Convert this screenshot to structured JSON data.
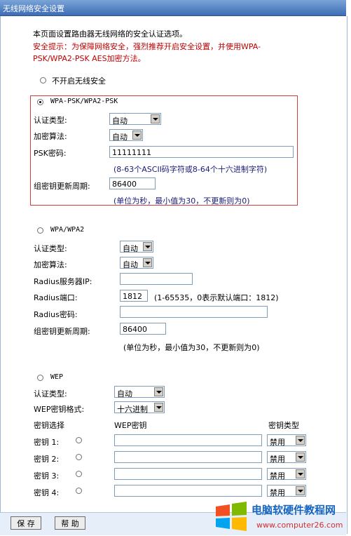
{
  "window": {
    "title": "无线网络安全设置"
  },
  "intro": {
    "line1": "本页面设置路由器无线网络的安全认证选项。",
    "hint_line1": "安全提示：为保障网络安全，强烈推荐开启安全设置，并使用WPA-",
    "hint_line2": "PSK/WPA2-PSK AES加密方法。"
  },
  "no_security": {
    "label": "不开启无线安全",
    "selected": false
  },
  "wpa_psk": {
    "title": "WPA-PSK/WPA2-PSK",
    "selected": true,
    "auth_label": "认证类型:",
    "auth_value": "自动",
    "enc_label": "加密算法:",
    "enc_value": "自动",
    "psk_label": "PSK密码:",
    "psk_value": "11111111",
    "psk_hint": "(8-63个ASCII码字符或8-64个十六进制字符)",
    "renew_label": "组密钥更新周期:",
    "renew_value": "86400",
    "renew_hint": "(单位为秒，最小值为30，不更新则为0)"
  },
  "wpa": {
    "title": "WPA/WPA2",
    "selected": false,
    "auth_label": "认证类型:",
    "auth_value": "自动",
    "enc_label": "加密算法:",
    "enc_value": "自动",
    "radius_ip_label": "Radius服务器IP:",
    "radius_ip_value": "",
    "radius_port_label": "Radius端口:",
    "radius_port_value": "1812",
    "radius_port_hint": "(1-65535，0表示默认端口：1812)",
    "radius_pwd_label": "Radius密码:",
    "radius_pwd_value": "",
    "renew_label": "组密钥更新周期:",
    "renew_value": "86400",
    "renew_hint": "(单位为秒，最小值为30，不更新则为0)"
  },
  "wep": {
    "title": "WEP",
    "selected": false,
    "auth_label": "认证类型:",
    "auth_value": "自动",
    "format_label": "WEP密钥格式:",
    "format_value": "十六进制",
    "col_select": "密钥选择",
    "col_key": "WEP密钥",
    "col_type": "密钥类型",
    "keys": [
      {
        "label": "密钥 1:",
        "value": "",
        "type": "禁用"
      },
      {
        "label": "密钥 2:",
        "value": "",
        "type": "禁用"
      },
      {
        "label": "密钥 3:",
        "value": "",
        "type": "禁用"
      },
      {
        "label": "密钥 4:",
        "value": "",
        "type": "禁用"
      }
    ]
  },
  "buttons": {
    "save": "保 存",
    "help": "帮 助"
  },
  "watermark": {
    "site_name": "电脑软硬件教程网",
    "url": "www.computer26.com"
  },
  "colors": {
    "hint_red": "#c00000",
    "title_bar": "#3d6cb5",
    "highlight_border": "#d43c3c"
  }
}
